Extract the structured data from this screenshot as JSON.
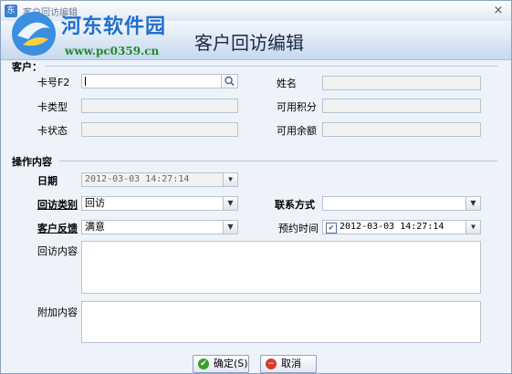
{
  "window": {
    "title": "客户回访编辑",
    "app_icon": "东",
    "close": "×"
  },
  "header": {
    "logo_text": "河东软件园",
    "logo_url": "www.pc0359.cn",
    "title": "客户回访编辑"
  },
  "customer": {
    "section_label": "客户：",
    "card_no_label": "卡号F2",
    "card_no_value": "",
    "name_label": "姓名",
    "card_type_label": "卡类型",
    "points_label": "可用积分",
    "card_status_label": "卡状态",
    "balance_label": "可用余额"
  },
  "operation": {
    "section_label": "操作内容",
    "date_label": "日期",
    "date_value": "2012-03-03 14:27:14",
    "visit_type_label": "回访类别",
    "visit_type_value": "回访",
    "contact_label": "联系方式",
    "contact_value": "",
    "feedback_label": "客户反馈",
    "feedback_value": "满意",
    "appointment_label": "预约时间",
    "appointment_checked": true,
    "appointment_value": "2012-03-03 14:27:14",
    "visit_content_label": "回访内容",
    "extra_content_label": "附加内容"
  },
  "buttons": {
    "ok_label": "确定(S)",
    "cancel_label": "取消(C)"
  },
  "icons": {
    "ok": "check-icon",
    "cancel": "minus-icon",
    "search": "magnifier-icon",
    "dropdown": "chevron-down-icon"
  },
  "colors": {
    "header_title": "#1a2a44",
    "logo_text": "#1e6fd0",
    "logo_url": "#1f8a2e",
    "ok_icon": "#3f9b2e",
    "cancel_icon": "#d43a2a"
  }
}
